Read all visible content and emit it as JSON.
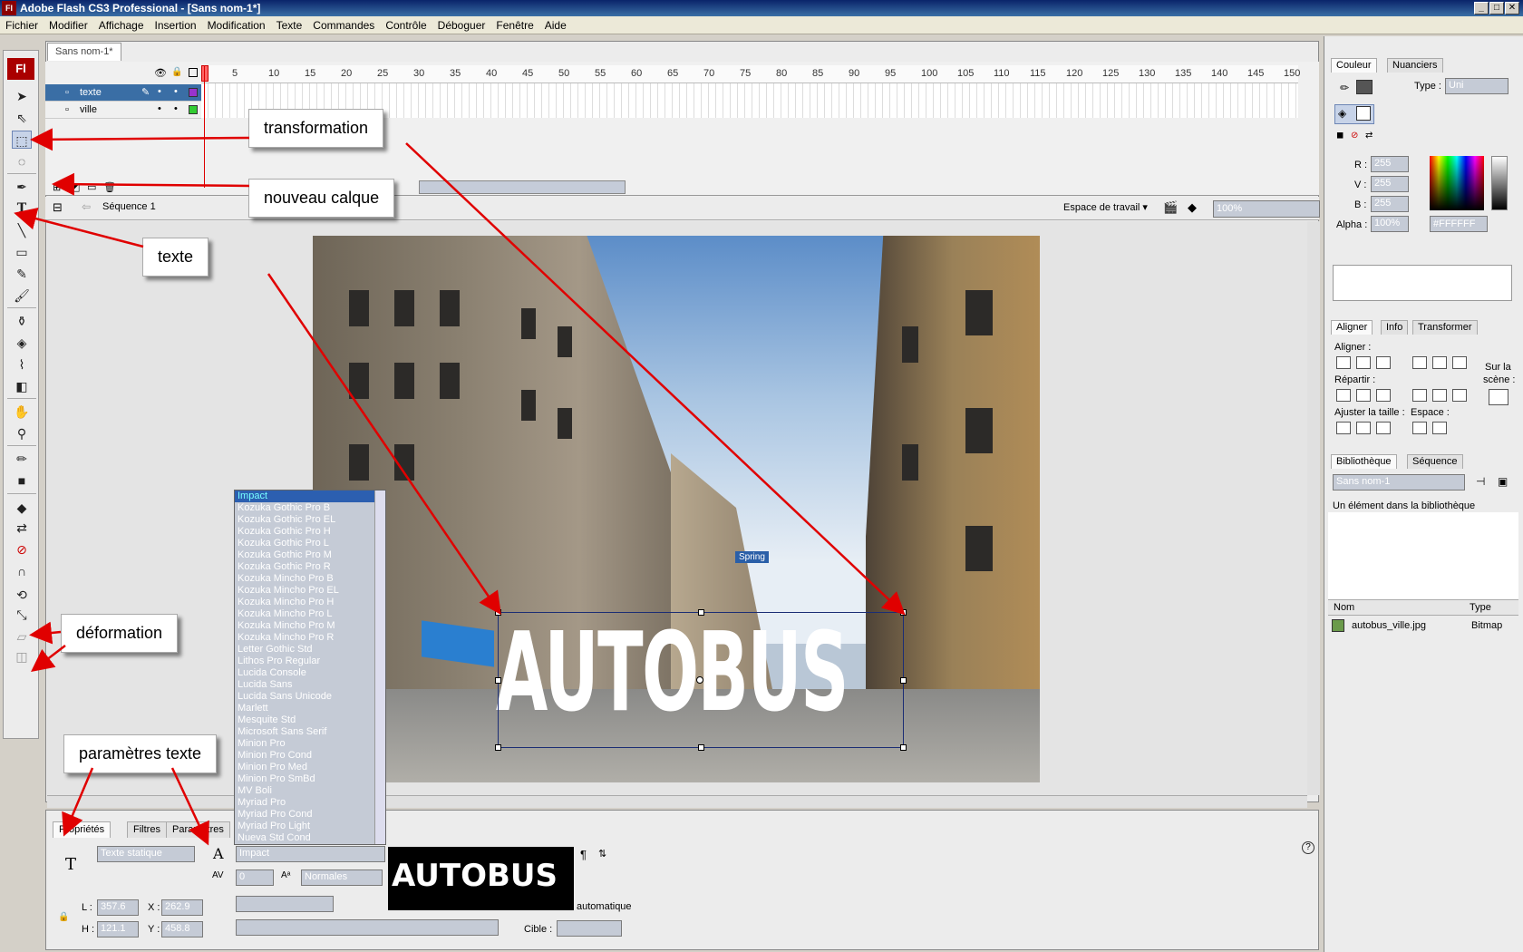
{
  "window": {
    "title": "Adobe Flash CS3 Professional - [Sans nom-1*]",
    "logo": "Fl",
    "buttons": [
      "_",
      "□",
      "✕"
    ]
  },
  "menu": [
    "Fichier",
    "Modifier",
    "Affichage",
    "Insertion",
    "Modification",
    "Texte",
    "Commandes",
    "Contrôle",
    "Déboguer",
    "Fenêtre",
    "Aide"
  ],
  "document": {
    "tab_label": "Sans nom-1*",
    "scene_label": "Séquence 1",
    "workspace_label": "Espace de travail ▾",
    "zoom": "100%"
  },
  "timeline": {
    "frame_numbers": [
      "1",
      "5",
      "10",
      "15",
      "20",
      "25",
      "30",
      "35",
      "40",
      "45",
      "50",
      "55",
      "60",
      "65",
      "70",
      "75",
      "80",
      "85",
      "90",
      "95",
      "100",
      "105",
      "110",
      "115",
      "120",
      "125",
      "130",
      "135",
      "140",
      "145",
      "150"
    ],
    "layers": [
      {
        "name": "texte",
        "color": "#9933cc",
        "active": true
      },
      {
        "name": "ville",
        "color": "#33cc33",
        "active": false
      }
    ]
  },
  "stage": {
    "text": "AUTOBUS",
    "sign_text": "Spring"
  },
  "font_list": {
    "selected": "Impact",
    "items": [
      "Impact",
      "Kozuka Gothic Pro B",
      "Kozuka Gothic Pro EL",
      "Kozuka Gothic Pro H",
      "Kozuka Gothic Pro L",
      "Kozuka Gothic Pro M",
      "Kozuka Gothic Pro R",
      "Kozuka Mincho Pro B",
      "Kozuka Mincho Pro EL",
      "Kozuka Mincho Pro H",
      "Kozuka Mincho Pro L",
      "Kozuka Mincho Pro M",
      "Kozuka Mincho Pro R",
      "Letter Gothic Std",
      "Lithos Pro Regular",
      "Lucida Console",
      "Lucida Sans",
      "Lucida Sans Unicode",
      "Marlett",
      "Mesquite Std",
      "Microsoft Sans Serif",
      "Minion Pro",
      "Minion Pro Cond",
      "Minion Pro Med",
      "Minion Pro SmBd",
      "MV Boli",
      "Myriad Pro",
      "Myriad Pro Cond",
      "Myriad Pro Light",
      "Nueva Std Cond"
    ]
  },
  "properties": {
    "tabs": [
      "Propriétés",
      "Filtres",
      "Paramètres"
    ],
    "text_type": "Texte statique",
    "font_value": "Impact",
    "spacing": "0",
    "baseline": "Normales",
    "width_label": "L :",
    "width": "357.6",
    "height_label": "H :",
    "height": "121.1",
    "x_label": "X :",
    "x": "262.9",
    "y_label": "Y :",
    "y": "458.8",
    "preview_text": "AUTOBUS",
    "auto_label": "automatique",
    "target_label": "Cible :"
  },
  "color_panel": {
    "tabs": [
      "Couleur",
      "Nuanciers"
    ],
    "type_label": "Type :",
    "type_value": "Uni",
    "r_label": "R :",
    "r": "255",
    "g_label": "V :",
    "g": "255",
    "b_label": "B :",
    "b": "255",
    "alpha_label": "Alpha :",
    "alpha": "100%",
    "hex": "#FFFFFF"
  },
  "align_panel": {
    "tabs": [
      "Aligner",
      "Info",
      "Transformer"
    ],
    "align_label": "Aligner :",
    "distribute_label": "Répartir :",
    "match_label": "Ajuster la taille :",
    "space_label": "Espace :",
    "stage_label_1": "Sur la",
    "stage_label_2": "scène :"
  },
  "library_panel": {
    "tabs": [
      "Bibliothèque",
      "Séquence"
    ],
    "doc_value": "Sans nom-1",
    "count_text": "Un élément dans la bibliothèque",
    "col_name": "Nom",
    "col_type": "Type",
    "item_name": "autobus_ville.jpg",
    "item_type": "Bitmap"
  },
  "annotations": {
    "transformation": "transformation",
    "new_layer": "nouveau calque",
    "text": "texte",
    "deformation": "déformation",
    "text_params": "paramètres texte"
  },
  "colors": {
    "accent": "#3a6ea5",
    "arrow": "#e00000",
    "selection": "#1b2d74"
  }
}
